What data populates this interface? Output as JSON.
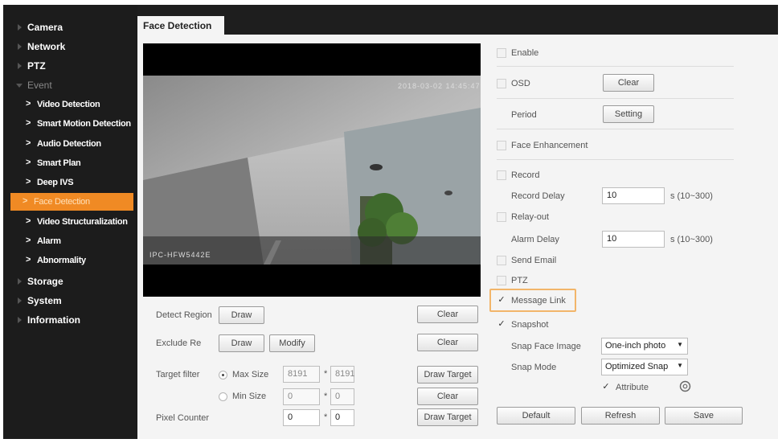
{
  "sidebar": {
    "top": [
      "Camera",
      "Network",
      "PTZ",
      "Event"
    ],
    "event_items": [
      "Video Detection",
      "Smart Motion Detection",
      "Audio Detection",
      "Smart Plan",
      "Deep IVS",
      "Face Detection",
      "Video Structuralization",
      "Alarm",
      "Abnormality"
    ],
    "bottom": [
      "Storage",
      "System",
      "Information"
    ]
  },
  "tab": {
    "title": "Face Detection"
  },
  "video": {
    "osd_time": "2018-03-02 14:45:47",
    "osd_name": "IPC-HFW5442E"
  },
  "left_controls": {
    "detect_region": "Detect Region",
    "exclude_region": "Exclude Re",
    "target_filter": "Target filter",
    "max_size": "Max Size",
    "min_size": "Min Size",
    "pixel_counter": "Pixel Counter",
    "draw": "Draw",
    "modify": "Modify",
    "clear": "Clear",
    "draw_target": "Draw Target",
    "max_w": "8191",
    "max_h": "8191",
    "min_w": "0",
    "min_h": "0",
    "pix_w": "0",
    "pix_h": "0",
    "times": "*"
  },
  "right": {
    "enable": "Enable",
    "osd": "OSD",
    "clear": "Clear",
    "period": "Period",
    "setting": "Setting",
    "face_enhancement": "Face Enhancement",
    "record": "Record",
    "record_delay": "Record Delay",
    "record_delay_val": "10",
    "range": "s (10~300)",
    "relay_out": "Relay-out",
    "alarm_delay": "Alarm Delay",
    "alarm_delay_val": "10",
    "send_email": "Send Email",
    "ptz": "PTZ",
    "message_link": "Message Link",
    "snapshot": "Snapshot",
    "snap_face_image": "Snap Face Image",
    "snap_face_image_val": "One-inch photo",
    "snap_mode": "Snap Mode",
    "snap_mode_val": "Optimized Snap",
    "attribute": "Attribute",
    "check": "✓"
  },
  "footer": {
    "default": "Default",
    "refresh": "Refresh",
    "save": "Save"
  },
  "colors": {
    "sidebar_bg": "#1c1c1c",
    "active": "#f08a24",
    "panel_bg": "#f4f4f4",
    "highlight": "#f2b56a"
  }
}
